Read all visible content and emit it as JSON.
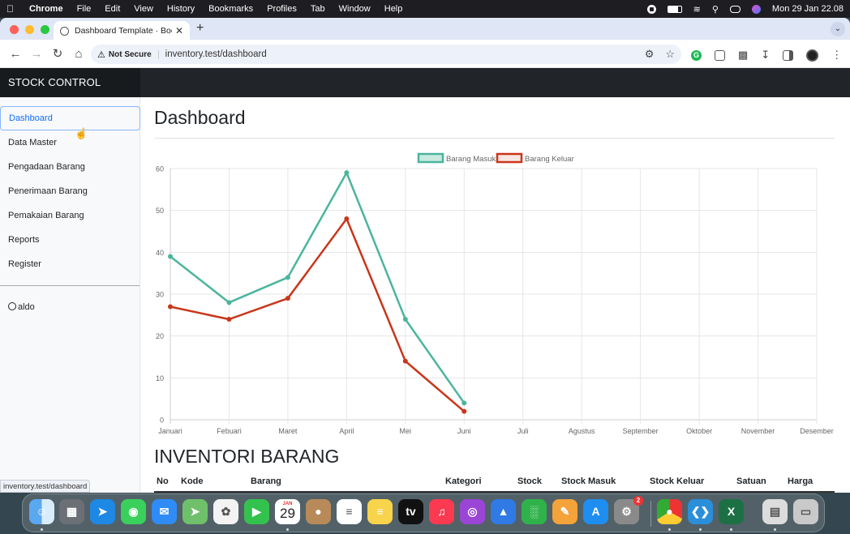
{
  "menubar": {
    "app": "Chrome",
    "items": [
      "File",
      "Edit",
      "View",
      "History",
      "Bookmarks",
      "Profiles",
      "Tab",
      "Window",
      "Help"
    ],
    "datetime": "Mon 29 Jan  22.08"
  },
  "browser": {
    "tab_title": "Dashboard Template · Bootst",
    "security_label": "Not Secure",
    "url": "inventory.test/dashboard",
    "status_url": "inventory.test/dashboard"
  },
  "app": {
    "brand": "STOCK CONTROL",
    "sidebar": {
      "items": [
        {
          "label": "Dashboard"
        },
        {
          "label": "Data Master"
        },
        {
          "label": "Pengadaan Barang"
        },
        {
          "label": "Penerimaan Barang"
        },
        {
          "label": "Pemakaian Barang"
        },
        {
          "label": "Reports"
        },
        {
          "label": "Register"
        }
      ],
      "user": "aldo"
    },
    "page_title": "Dashboard",
    "section_title": "INVENTORI BARANG",
    "table_headers": [
      "No",
      "Kode",
      "Barang",
      "Kategori",
      "Stock",
      "Stock Masuk",
      "Stock Keluar",
      "Satuan",
      "Harga"
    ]
  },
  "chart_data": {
    "type": "line",
    "categories": [
      "Januari",
      "Febuari",
      "Maret",
      "April",
      "Mei",
      "Juni",
      "Juli",
      "Agustus",
      "September",
      "Oktober",
      "November",
      "Desember"
    ],
    "series": [
      {
        "name": "Barang Masuk",
        "values": [
          39,
          28,
          34,
          59,
          24,
          4
        ],
        "color": "#4bb59c"
      },
      {
        "name": "Barang Keluar",
        "values": [
          27,
          24,
          29,
          48,
          14,
          2
        ],
        "color": "#c9361a"
      }
    ],
    "ylim": [
      0,
      60
    ],
    "yticks": [
      0,
      10,
      20,
      30,
      40,
      50,
      60
    ],
    "grid": true,
    "legend": "top-center"
  },
  "dock": {
    "apps": [
      "finder-icon",
      "launchpad-icon",
      "safari-icon",
      "messages-icon",
      "mail-icon",
      "maps-icon",
      "photos-icon",
      "facetime-icon",
      "calendar-icon",
      "contacts-icon",
      "reminders-icon",
      "notes-icon",
      "tv-icon",
      "music-icon",
      "podcasts-icon",
      "keynote-icon",
      "numbers-icon",
      "pages-icon",
      "appstore-icon",
      "settings-icon",
      "chrome-icon",
      "vscode-icon",
      "excel-icon",
      "preview-icon",
      "trash-icon"
    ],
    "calendar_month": "JAN",
    "calendar_day": "29",
    "settings_badge": "2"
  }
}
